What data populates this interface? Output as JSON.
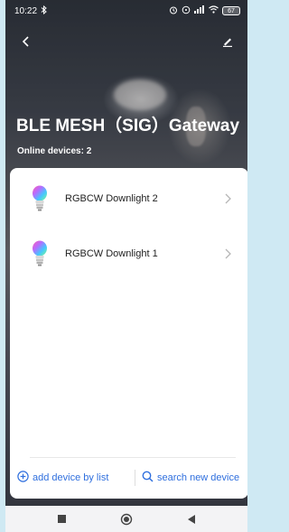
{
  "status_bar": {
    "time": "10:22",
    "bluetooth_icon": "bluetooth-icon",
    "right_icons": [
      "alarm-icon",
      "timer-icon",
      "signal-icon",
      "wifi-icon"
    ],
    "battery": "67"
  },
  "header": {
    "back_icon": "chevron-left-icon",
    "edit_icon": "edit-icon",
    "title": "BLE MESH（SIG）Gateway",
    "online_devices": "Online devices: 2"
  },
  "devices": [
    {
      "name": "RGBCW Downlight 2",
      "icon": "bulb-icon"
    },
    {
      "name": "RGBCW Downlight 1",
      "icon": "bulb-icon"
    }
  ],
  "footer": {
    "add_label": "add device by list",
    "search_label": "search new device",
    "accent": "#2f6fde"
  },
  "nav": {
    "items": [
      "recent-apps-icon",
      "home-icon",
      "back-icon"
    ]
  }
}
